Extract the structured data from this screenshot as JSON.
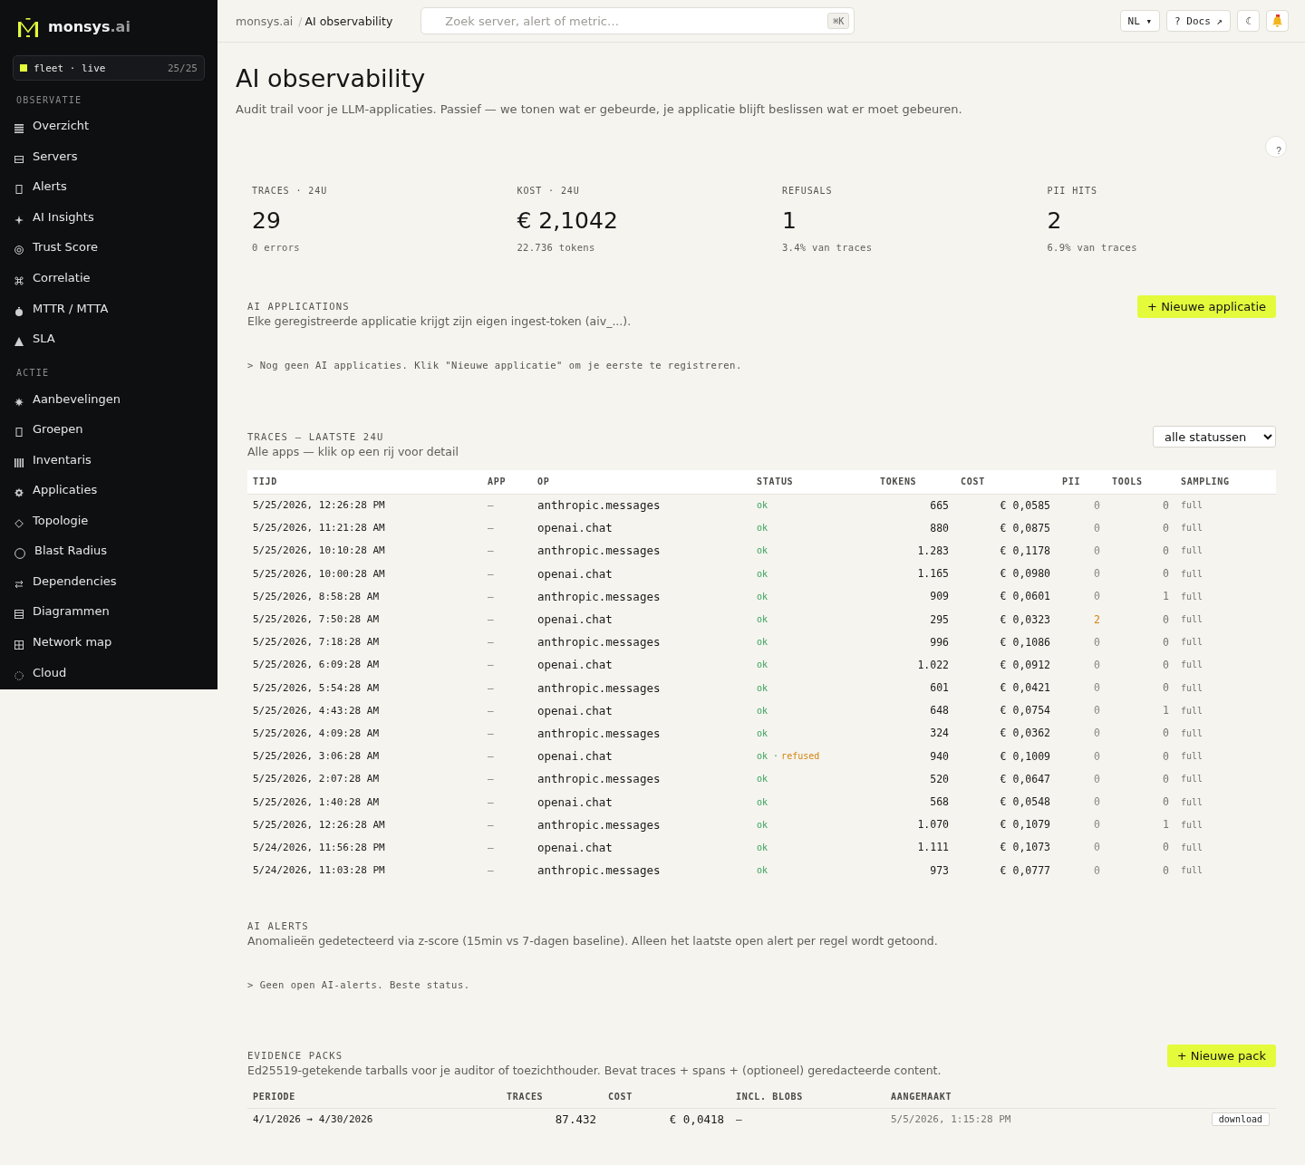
{
  "sidebar": {
    "brand": {
      "name": "monsys",
      "suffix": ".ai"
    },
    "fleet": {
      "label": "fleet · live",
      "count": "25/25"
    },
    "sections": [
      {
        "title": "OBSERVATIE",
        "items": [
          {
            "label": "Overzicht",
            "selected": false
          },
          {
            "label": "Servers",
            "selected": false
          },
          {
            "label": "Alerts",
            "selected": false
          },
          {
            "label": "AI Insights",
            "selected": false
          },
          {
            "label": "Trust Score",
            "selected": false
          },
          {
            "label": "Correlatie",
            "selected": false
          },
          {
            "label": "MTTR / MTTA",
            "selected": false
          },
          {
            "label": "SLA",
            "selected": false
          }
        ]
      },
      {
        "title": "ACTIE",
        "items": [
          {
            "label": "Aanbevelingen",
            "selected": false
          },
          {
            "label": "Groepen",
            "selected": false
          },
          {
            "label": "Inventaris",
            "selected": false
          },
          {
            "label": "Applicaties",
            "selected": false
          },
          {
            "label": "Topologie",
            "selected": false
          },
          {
            "label": "Blast Radius",
            "selected": false
          },
          {
            "label": "Dependencies",
            "selected": false
          },
          {
            "label": "Diagrammen",
            "selected": false
          },
          {
            "label": "Network map",
            "selected": false
          },
          {
            "label": "Cloud",
            "selected": false
          }
        ]
      }
    ]
  },
  "topbar": {
    "breadcrumb": {
      "parent": "monsys.ai",
      "separator": "/",
      "current": "AI observability"
    },
    "search": {
      "placeholder": "Zoek server, alert of metric…",
      "shortcut": "⌘K"
    },
    "language": "NL ▾",
    "docs": "? Docs ↗",
    "theme": "☾"
  },
  "page": {
    "title": "AI observability",
    "subtitle": "Audit trail voor je LLM-applicaties. Passief — we tonen wat er gebeurde, je applicatie blijft beslissen wat er moet gebeuren.",
    "help": "?"
  },
  "stats": [
    {
      "label": "TRACES · 24U",
      "value": "29",
      "note": "0 errors"
    },
    {
      "label": "KOST · 24U",
      "value": "€ 2,1042",
      "note": "22.736 tokens"
    },
    {
      "label": "REFUSALS",
      "value": "1",
      "note": "3.4% van traces"
    },
    {
      "label": "PII HITS",
      "value": "2",
      "note": "6.9% van traces"
    }
  ],
  "applications": {
    "title": "AI APPLICATIONS",
    "description": "Elke geregistreerde applicatie krijgt zijn eigen ingest-token (aiv_...).",
    "button": "+ Nieuwe applicatie",
    "empty": "> Nog geen AI applicaties. Klik \"Nieuwe applicatie\" om je eerste te registreren."
  },
  "traces": {
    "title": "TRACES — LAATSTE 24U",
    "description": "Alle apps — klik op een rij voor detail",
    "filter": "alle statussen",
    "columns": [
      "TIJD",
      "APP",
      "OP",
      "STATUS",
      "TOKENS",
      "COST",
      "PII",
      "TOOLS",
      "SAMPLING"
    ],
    "rows": [
      {
        "time": "5/25/2026, 12:26:28 PM",
        "app": "—",
        "op": "anthropic.messages",
        "status": "ok",
        "tokens": "665",
        "cost": "€ 0,0585",
        "pii": "0",
        "pii_flagged": false,
        "tools": "0",
        "sampling": "full"
      },
      {
        "time": "5/25/2026, 11:21:28 AM",
        "app": "—",
        "op": "openai.chat",
        "status": "ok",
        "tokens": "880",
        "cost": "€ 0,0875",
        "pii": "0",
        "pii_flagged": false,
        "tools": "0",
        "sampling": "full"
      },
      {
        "time": "5/25/2026, 10:10:28 AM",
        "app": "—",
        "op": "anthropic.messages",
        "status": "ok",
        "tokens": "1.283",
        "cost": "€ 0,1178",
        "pii": "0",
        "pii_flagged": false,
        "tools": "0",
        "sampling": "full"
      },
      {
        "time": "5/25/2026, 10:00:28 AM",
        "app": "—",
        "op": "openai.chat",
        "status": "ok",
        "tokens": "1.165",
        "cost": "€ 0,0980",
        "pii": "0",
        "pii_flagged": false,
        "tools": "0",
        "sampling": "full"
      },
      {
        "time": "5/25/2026, 8:58:28 AM",
        "app": "—",
        "op": "anthropic.messages",
        "status": "ok",
        "tokens": "909",
        "cost": "€ 0,0601",
        "pii": "0",
        "pii_flagged": false,
        "tools": "1",
        "sampling": "full"
      },
      {
        "time": "5/25/2026, 7:50:28 AM",
        "app": "—",
        "op": "openai.chat",
        "status": "ok",
        "tokens": "295",
        "cost": "€ 0,0323",
        "pii": "2",
        "pii_flagged": true,
        "tools": "0",
        "sampling": "full"
      },
      {
        "time": "5/25/2026, 7:18:28 AM",
        "app": "—",
        "op": "anthropic.messages",
        "status": "ok",
        "tokens": "996",
        "cost": "€ 0,1086",
        "pii": "0",
        "pii_flagged": false,
        "tools": "0",
        "sampling": "full"
      },
      {
        "time": "5/25/2026, 6:09:28 AM",
        "app": "—",
        "op": "openai.chat",
        "status": "ok",
        "tokens": "1.022",
        "cost": "€ 0,0912",
        "pii": "0",
        "pii_flagged": false,
        "tools": "0",
        "sampling": "full"
      },
      {
        "time": "5/25/2026, 5:54:28 AM",
        "app": "—",
        "op": "anthropic.messages",
        "status": "ok",
        "tokens": "601",
        "cost": "€ 0,0421",
        "pii": "0",
        "pii_flagged": false,
        "tools": "0",
        "sampling": "full"
      },
      {
        "time": "5/25/2026, 4:43:28 AM",
        "app": "—",
        "op": "openai.chat",
        "status": "ok",
        "tokens": "648",
        "cost": "€ 0,0754",
        "pii": "0",
        "pii_flagged": false,
        "tools": "1",
        "sampling": "full"
      },
      {
        "time": "5/25/2026, 4:09:28 AM",
        "app": "—",
        "op": "anthropic.messages",
        "status": "ok",
        "tokens": "324",
        "cost": "€ 0,0362",
        "pii": "0",
        "pii_flagged": false,
        "tools": "0",
        "sampling": "full"
      },
      {
        "time": "5/25/2026, 3:06:28 AM",
        "app": "—",
        "op": "openai.chat",
        "status": "ok",
        "status_separator": "·",
        "status_note": "refused",
        "tokens": "940",
        "cost": "€ 0,1009",
        "pii": "0",
        "pii_flagged": false,
        "tools": "0",
        "sampling": "full"
      },
      {
        "time": "5/25/2026, 2:07:28 AM",
        "app": "—",
        "op": "anthropic.messages",
        "status": "ok",
        "tokens": "520",
        "cost": "€ 0,0647",
        "pii": "0",
        "pii_flagged": false,
        "tools": "0",
        "sampling": "full"
      },
      {
        "time": "5/25/2026, 1:40:28 AM",
        "app": "—",
        "op": "openai.chat",
        "status": "ok",
        "tokens": "568",
        "cost": "€ 0,0548",
        "pii": "0",
        "pii_flagged": false,
        "tools": "0",
        "sampling": "full"
      },
      {
        "time": "5/25/2026, 12:26:28 AM",
        "app": "—",
        "op": "anthropic.messages",
        "status": "ok",
        "tokens": "1.070",
        "cost": "€ 0,1079",
        "pii": "0",
        "pii_flagged": false,
        "tools": "1",
        "sampling": "full"
      },
      {
        "time": "5/24/2026, 11:56:28 PM",
        "app": "—",
        "op": "openai.chat",
        "status": "ok",
        "tokens": "1.111",
        "cost": "€ 0,1073",
        "pii": "0",
        "pii_flagged": false,
        "tools": "0",
        "sampling": "full"
      },
      {
        "time": "5/24/2026, 11:03:28 PM",
        "app": "—",
        "op": "anthropic.messages",
        "status": "ok",
        "tokens": "973",
        "cost": "€ 0,0777",
        "pii": "0",
        "pii_flagged": false,
        "tools": "0",
        "sampling": "full"
      }
    ]
  },
  "alerts": {
    "title": "AI ALERTS",
    "description": "Anomalieën gedetecteerd via z-score (15min vs 7-dagen baseline). Alleen het laatste open alert per regel wordt getoond.",
    "empty": "> Geen open AI-alerts. Beste status."
  },
  "evidence": {
    "title": "EVIDENCE PACKS",
    "description": "Ed25519-getekende tarballs voor je auditor of toezichthouder. Bevat traces + spans + (optioneel) geredacteerde content.",
    "button": "+ Nieuwe pack",
    "columns": [
      "PERIODE",
      "TRACES",
      "COST",
      "INCL. BLOBS",
      "AANGEMAAKT"
    ],
    "rows": [
      {
        "period": "4/1/2026 → 4/30/2026",
        "traces": "87.432",
        "cost": "€ 0,0418",
        "blobs": "—",
        "created": "5/5/2026, 1:15:28 PM",
        "action": "download"
      }
    ]
  }
}
